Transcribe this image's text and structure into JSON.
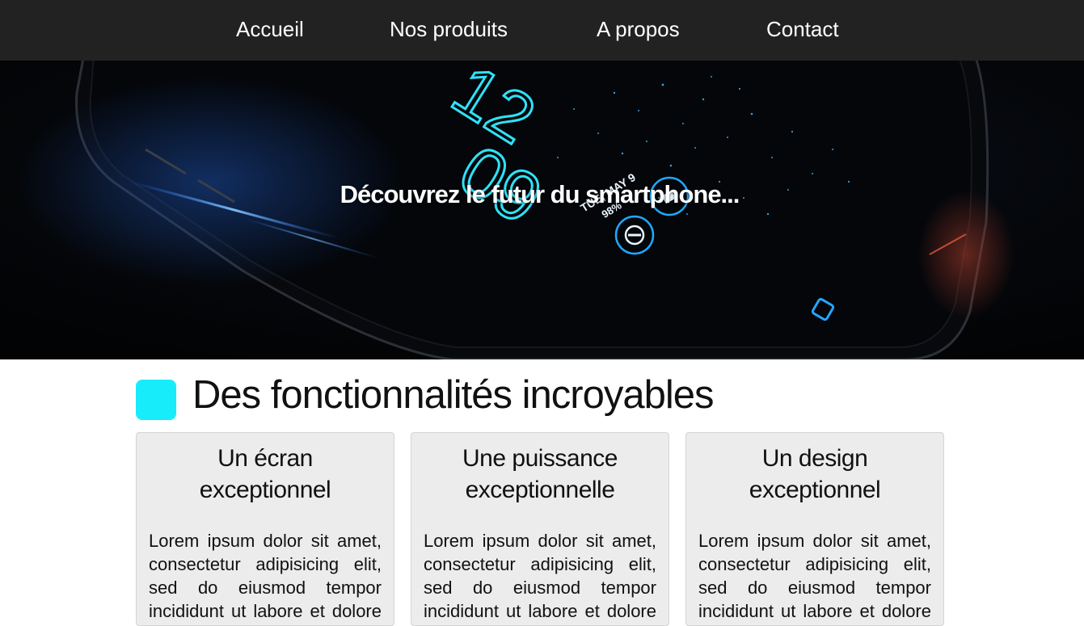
{
  "nav": {
    "items": [
      {
        "label": "Accueil"
      },
      {
        "label": "Nos produits"
      },
      {
        "label": "A propos"
      },
      {
        "label": "Contact"
      }
    ]
  },
  "hero": {
    "tagline": "Découvrez le futur du smartphone...",
    "phone_screen": {
      "clock_hour": "12",
      "clock_minute": "09",
      "date": "TUE, MAY 9",
      "battery": "98%"
    }
  },
  "features": {
    "title": "Des fonctionnalités incroyables",
    "accent_color": "#17ecfa",
    "cards": [
      {
        "title": "Un écran exceptionnel",
        "text": "Lorem ipsum dolor sit amet, consectetur adipisicing elit, sed do eiusmod tempor incididunt ut labore et dolore magna aliqua."
      },
      {
        "title": "Une puissance exceptionnelle",
        "text": "Lorem ipsum dolor sit amet, consectetur adipisicing elit, sed do eiusmod tempor incididunt ut labore et dolore magna aliqua."
      },
      {
        "title": "Un design exceptionnel",
        "text": "Lorem ipsum dolor sit amet, consectetur adipisicing elit, sed do eiusmod tempor incididunt ut labore et dolore magna aliqua."
      }
    ]
  },
  "colors": {
    "nav_background": "#222222",
    "card_background": "#ececec",
    "neon_blue": "#1fd8f0"
  }
}
